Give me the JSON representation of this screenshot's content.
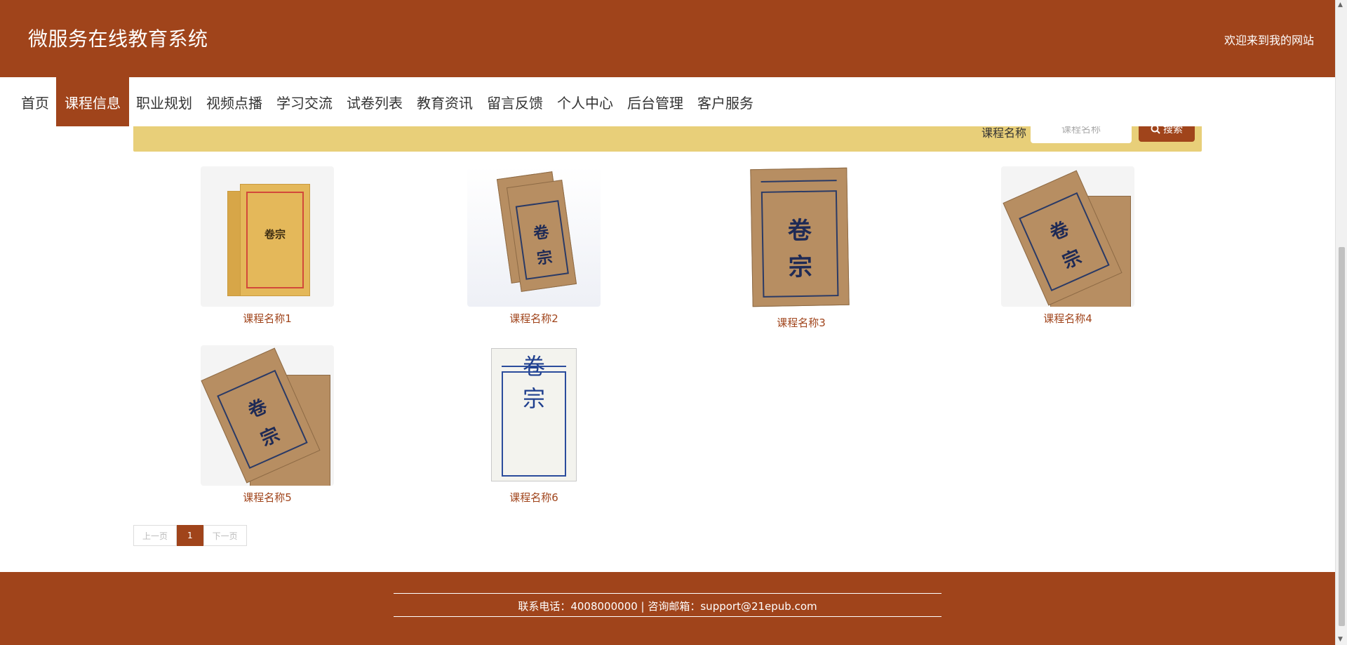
{
  "header": {
    "site_title": "微服务在线教育系统",
    "welcome": "欢迎来到我的网站"
  },
  "nav": {
    "items": [
      {
        "label": "首页",
        "active": false
      },
      {
        "label": "课程信息",
        "active": true
      },
      {
        "label": "职业规划",
        "active": false
      },
      {
        "label": "视频点播",
        "active": false
      },
      {
        "label": "学习交流",
        "active": false
      },
      {
        "label": "试卷列表",
        "active": false
      },
      {
        "label": "教育资讯",
        "active": false
      },
      {
        "label": "留言反馈",
        "active": false
      },
      {
        "label": "个人中心",
        "active": false
      },
      {
        "label": "后台管理",
        "active": false
      },
      {
        "label": "客户服务",
        "active": false
      }
    ]
  },
  "search": {
    "label": "课程名称",
    "placeholder": "课程名称",
    "button_label": "搜索"
  },
  "courses": [
    {
      "name": "课程名称1"
    },
    {
      "name": "课程名称2"
    },
    {
      "name": "课程名称3"
    },
    {
      "name": "课程名称4"
    },
    {
      "name": "课程名称5"
    },
    {
      "name": "课程名称6"
    }
  ],
  "thumb_text": {
    "juan": "卷",
    "zong": "宗",
    "juanzong": "卷宗"
  },
  "pagination": {
    "prev_label": "上一页",
    "current_page": "1",
    "next_label": "下一页"
  },
  "footer": {
    "contact": "联系电话：4008000000 | 咨询邮箱：support@21epub.com"
  },
  "colors": {
    "brand": "#a0441b",
    "search_bar": "#e8cf79"
  }
}
